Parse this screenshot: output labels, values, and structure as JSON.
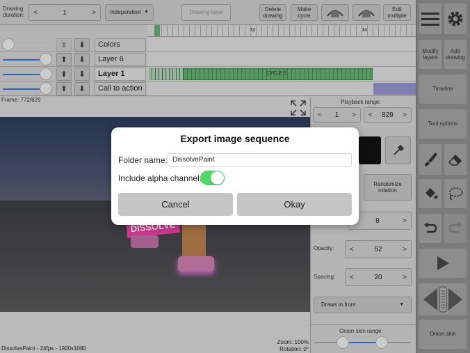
{
  "topbar": {
    "drawing_duration_label": "Drawing\nduration:",
    "duration_value": "1",
    "prev": "<",
    "next": ">",
    "mode": "Independent",
    "mode_caret": "▼",
    "drawing_label": "Drawing label",
    "delete_drawing": "Delete\ndrawing",
    "make_cycle": "Make\ncycle",
    "edit_multiple": "Edit\nmultiple"
  },
  "ruler": {
    "ticks": [
      "33",
      "34"
    ]
  },
  "layers": [
    {
      "name": "Colors",
      "opacity": 0.0
    },
    {
      "name": "Layer 6",
      "opacity": 1.0
    },
    {
      "name": "Layer 1",
      "opacity": 1.0,
      "active": true,
      "clip_label": "CYCLE 5"
    },
    {
      "name": "Call to action",
      "opacity": 1.0
    }
  ],
  "canvas": {
    "frame_label": "Frame: 772/829",
    "footer_left": "DissolvePaint - 24fps - 1920x1080",
    "zoom": "Zoom: 100%",
    "rotation": "Rotation: 0°",
    "poster_text": "DISSOLVE"
  },
  "panel": {
    "playback_range_label": "Playback range:",
    "range_start": "1",
    "range_end": "829",
    "randomize_rotation": "Randomize\nrotation",
    "size_value": "8",
    "opacity_label": "Opacity:",
    "opacity_value": "52",
    "spacing_label": "Spacing:",
    "spacing_value": "20",
    "draws_in_front": "Draws in front",
    "onion_label": "Onion skin range:"
  },
  "toolbar": {
    "modify_layers": "Modify\nlayers",
    "add_drawing": "Add\ndrawing",
    "timeline": "Timeline",
    "tool_options": "Tool options",
    "onion_skin": "Onion skin"
  },
  "dialog": {
    "title": "Export image sequence",
    "folder_label": "Folder name:",
    "folder_value": "DissolvePaint",
    "alpha_label": "Include alpha channel:",
    "alpha_on": true,
    "cancel": "Cancel",
    "okay": "Okay"
  },
  "colors": {
    "toggle_on": "#4cd964",
    "cycle_green": "#5faa6d",
    "accent_blue": "#2f6fd6",
    "purple": "#8f8cc8"
  }
}
